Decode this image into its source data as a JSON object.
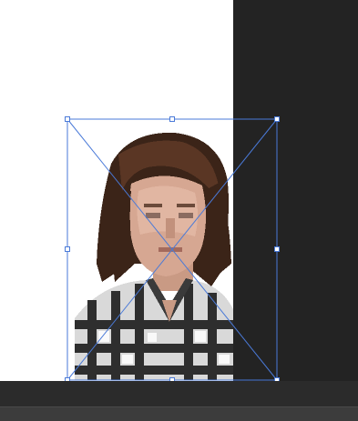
{
  "canvas": {
    "paper_color": "#ffffff",
    "pasteboard_color": "#232323"
  },
  "layer": {
    "content": "photo-portrait",
    "selection_color": "#4a7ad8"
  },
  "transform": {
    "handles": [
      "top-left",
      "top-center",
      "top-right",
      "middle-left",
      "middle-right",
      "bottom-left",
      "bottom-center",
      "bottom-right"
    ]
  }
}
